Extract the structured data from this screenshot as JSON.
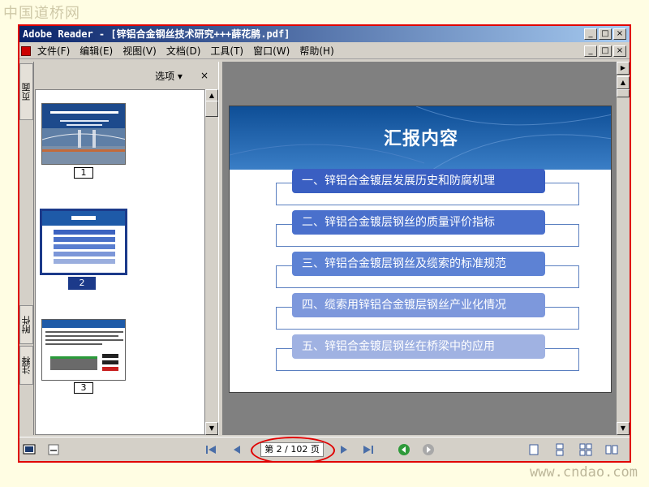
{
  "watermark": {
    "top": "中国道桥网",
    "bottom": "www.cndao.com"
  },
  "window": {
    "title": "Adobe Reader - [锌铝合金钢丝技术研究+++薛花鹃.pdf]",
    "buttons": [
      "_",
      "□",
      "×"
    ]
  },
  "menubar": {
    "items": [
      "文件(F)",
      "编辑(E)",
      "视图(V)",
      "文档(D)",
      "工具(T)",
      "窗口(W)",
      "帮助(H)"
    ]
  },
  "side_tabs": [
    "页面",
    "附件",
    "注释"
  ],
  "panel": {
    "options_label": "选项 ▾",
    "close_glyph": "×",
    "page_labels": [
      "1",
      "2",
      "3"
    ]
  },
  "slide": {
    "title": "汇报内容",
    "items": [
      "一、锌铝合金镀层发展历史和防腐机理",
      "二、锌铝合金镀层钢丝的质量评价指标",
      "三、锌铝合金镀层钢丝及缆索的标准规范",
      "四、缆索用锌铝合金镀层钢丝产业化情况",
      "五、锌铝合金镀层钢丝在桥梁中的应用"
    ]
  },
  "navigation": {
    "page_display": "第 2 / 102 页",
    "current_page": 2,
    "total_pages": 102
  },
  "colors": {
    "frame_border": "#e00000",
    "title_gradient_start": "#0a246a",
    "banner": "#1a5aa8"
  }
}
